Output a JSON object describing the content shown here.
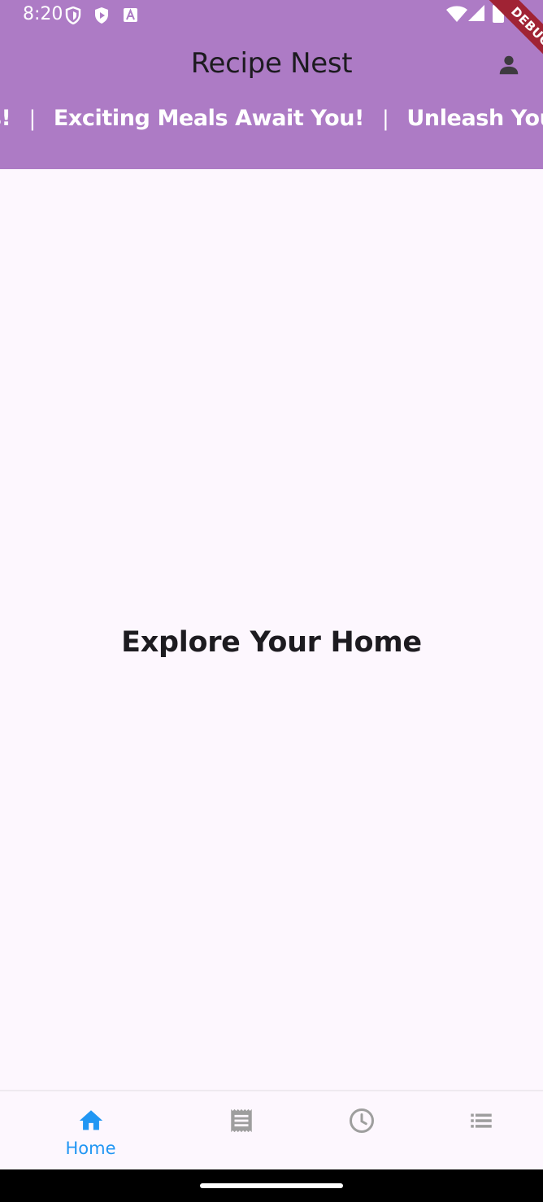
{
  "status_bar": {
    "time": "8:20",
    "icons": [
      "shield-icon",
      "play-protect-icon",
      "font-a-icon",
      "wifi-icon",
      "signal-icon",
      "battery-icon"
    ]
  },
  "app_bar": {
    "title": "Recipe Nest",
    "profile_icon": "person-icon",
    "marquee": {
      "items": [
        "ls!",
        "Exciting Meals Await You!",
        "Unleash Your"
      ],
      "separator": "|"
    }
  },
  "debug_banner": "DEBUG",
  "main": {
    "heading": "Explore Your Home"
  },
  "bottom_nav": {
    "items": [
      {
        "label": "Home",
        "icon": "home-icon",
        "selected": true
      },
      {
        "label": "",
        "icon": "receipt-icon",
        "selected": false
      },
      {
        "label": "",
        "icon": "clock-icon",
        "selected": false
      },
      {
        "label": "",
        "icon": "list-icon",
        "selected": false
      }
    ]
  },
  "colors": {
    "app_bar": "#AD7BC5",
    "background": "#FDF7FE",
    "nav_selected": "#2196F3",
    "nav_unselected": "#9E9E9E",
    "debug_banner": "#A02334"
  }
}
